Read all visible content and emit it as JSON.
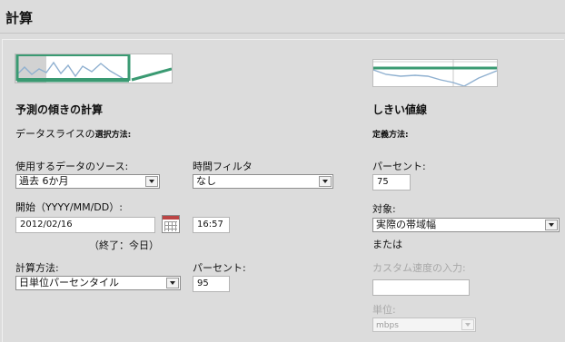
{
  "header": {
    "title": "計算"
  },
  "forecast": {
    "heading": "予測の傾きの計算",
    "slice_prefix": "データスライスの",
    "slice_suffix": "選択方法:",
    "source_label": "使用するデータのソース:",
    "source_value": "過去 6か月",
    "time_filter_label": "時間フィルタ",
    "time_filter_value": "なし",
    "start_label": "開始（YYYY/MM/DD）:",
    "start_date": "2012/02/16",
    "start_time": "16:57",
    "end_note": "（終了：今日）",
    "calc_method_label": "計算方法:",
    "calc_method_value": "日単位パーセンタイル",
    "percent_label": "パーセント:",
    "percent_value": "95"
  },
  "threshold": {
    "heading": "しきい値線",
    "definition_label": "定義方法:",
    "percent_label": "パーセント:",
    "percent_value": "75",
    "target_label": "対象:",
    "target_value": "実際の帯域幅",
    "or_label": "または",
    "custom_speed_label": "カスタム速度の入力:",
    "custom_speed_value": "",
    "unit_label": "単位:",
    "unit_value": "mbps"
  },
  "colors": {
    "accent_green": "#3a9a72",
    "chart_line": "#8fb0d0"
  },
  "icons": {
    "calendar": "calendar-icon"
  }
}
